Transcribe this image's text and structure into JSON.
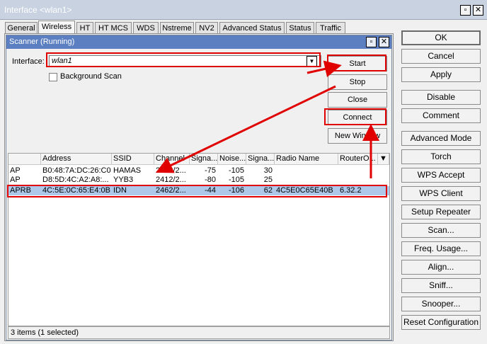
{
  "window": {
    "title": "Interface <wlan1>",
    "min_icon": "restore-icon",
    "close_icon": "close-icon"
  },
  "tabs": [
    {
      "label": "General"
    },
    {
      "label": "Wireless"
    },
    {
      "label": "HT"
    },
    {
      "label": "HT MCS"
    },
    {
      "label": "WDS"
    },
    {
      "label": "Nstreme"
    },
    {
      "label": "NV2"
    },
    {
      "label": "Advanced Status"
    },
    {
      "label": "Status"
    },
    {
      "label": "Traffic"
    }
  ],
  "active_tab": "Wireless",
  "scanner": {
    "title": "Scanner (Running)",
    "interface_label": "Interface:",
    "interface_value": "wlan1",
    "background_scan_label": "Background Scan",
    "background_scan_checked": false,
    "buttons": {
      "start": "Start",
      "stop": "Stop",
      "close": "Close",
      "connect": "Connect",
      "new_window": "New Window"
    },
    "columns": [
      "",
      "Address",
      "SSID",
      "Channel",
      "Signa...",
      "Noise...",
      "Signa...",
      "Radio Name",
      "RouterO..."
    ],
    "rows": [
      [
        "AP",
        "B0:48:7A:DC:26:C0",
        "HAMAS",
        "2412/2...",
        "-75",
        "-105",
        "30",
        "",
        ""
      ],
      [
        "AP",
        "D8:5D:4C:A2:A8:...",
        "YYB3",
        "2412/2...",
        "-80",
        "-105",
        "25",
        "",
        ""
      ],
      [
        "APRB",
        "4C:5E:0C:65:E4:0B",
        "IDN",
        "2462/2...",
        "-44",
        "-106",
        "62",
        "4C5E0C65E40B",
        "6.32.2"
      ]
    ],
    "selected_row": 2,
    "status": "3 items (1 selected)"
  },
  "side_buttons": [
    "OK",
    "Cancel",
    "Apply",
    "Disable",
    "Comment",
    "Advanced Mode",
    "Torch",
    "WPS Accept",
    "WPS Client",
    "Setup Repeater",
    "Scan...",
    "Freq. Usage...",
    "Align...",
    "Sniff...",
    "Snooper...",
    "Reset Configuration"
  ],
  "colors": {
    "annotation": "#e00000",
    "scanner_title": "#5b7fc0",
    "selected_row": "#adc8e9"
  }
}
